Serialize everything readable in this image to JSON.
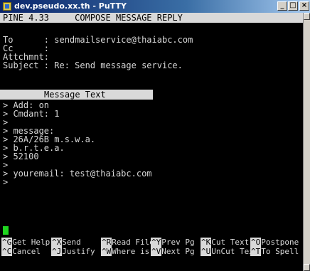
{
  "window": {
    "title": "dev.pseudo.xx.th - PuTTY",
    "controls": {
      "minimize": "_",
      "maximize": "□",
      "close": "×"
    }
  },
  "pine": {
    "header": "PINE 4.33     COMPOSE MESSAGE REPLY",
    "to": "To      : sendmailservice@thaiabc.com",
    "cc": "Cc      :",
    "attchmnt": "Attchmnt:",
    "subject": "Subject : Re: Send message service.",
    "banner": "Message Text",
    "body": [
      "> Add: on",
      "> Cmdant: 1",
      ">",
      "> message:",
      "> 26A/26B m.s.w.a.",
      "> b.r.t.e.a.",
      "> 52100",
      ">",
      "> youremail: test@thaiabc.com",
      ">"
    ],
    "cursor_color": "#1fd51f",
    "commands_row1": [
      {
        "key": "^G",
        "label": "Get Help"
      },
      {
        "key": "^X",
        "label": "Send"
      },
      {
        "key": "^R",
        "label": "Read File"
      },
      {
        "key": "^Y",
        "label": "Prev Pg"
      },
      {
        "key": "^K",
        "label": "Cut Text"
      },
      {
        "key": "^O",
        "label": "Postpone"
      }
    ],
    "commands_row2": [
      {
        "key": "^C",
        "label": "Cancel"
      },
      {
        "key": "^J",
        "label": "Justify"
      },
      {
        "key": "^W",
        "label": "Where is"
      },
      {
        "key": "^V",
        "label": "Next Pg"
      },
      {
        "key": "^U",
        "label": "UnCut Text"
      },
      {
        "key": "^T",
        "label": "To Spell"
      }
    ]
  }
}
